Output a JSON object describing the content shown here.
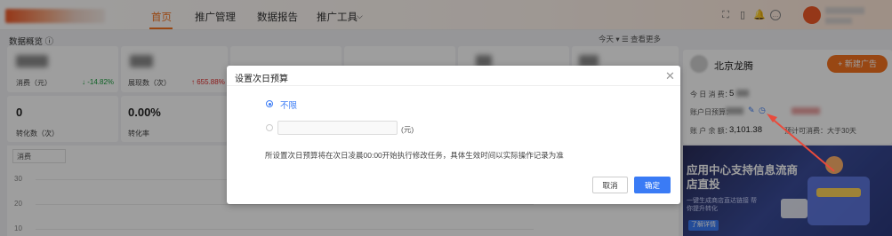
{
  "nav": {
    "items": [
      "首页",
      "推广管理",
      "数据报告",
      "推广工具"
    ],
    "active_index": 0,
    "chevron": "chevron-down-icon"
  },
  "toolbar_icons": [
    "screen-icon",
    "mobile-icon",
    "bell-icon",
    "more-icon"
  ],
  "section": {
    "title": "数据概览 ⓘ",
    "range": "今天 ▾  ☰ 查看更多"
  },
  "metrics": [
    {
      "label": "消费（元）",
      "delta": "↓ -14.82%",
      "delta_color": "#1b9e3e"
    },
    {
      "label": "展现数（次）",
      "delta": "↑ 655.88%",
      "delta_color": "#e02b2b"
    }
  ],
  "metrics_row2": [
    {
      "value": "0",
      "label": "转化数（次）"
    },
    {
      "value": "0.00%",
      "label": "转化率"
    }
  ],
  "chart": {
    "select": "消费",
    "yticks": [
      "30",
      "20",
      "10"
    ]
  },
  "account": {
    "name": "北京龙腾",
    "new_ad_button": "+ 新建广告",
    "today_spend_label": "今 日 消 费：",
    "today_spend_value": "5",
    "budget_label": "账户日预算：",
    "balance_label": "账 户 余 额：",
    "balance_value": "3,101.38",
    "balance_note": "预计可消费：大于30天"
  },
  "banner": {
    "title": "应用中心支持信息流商店直投",
    "sub": "一键生成商店直达链接 帮你提升转化",
    "button": "了解详情"
  },
  "modal": {
    "title": "设置次日预算",
    "option_unlimited": "不限",
    "budget_placeholder": "",
    "unit": "(元)",
    "note": "所设置次日预算将在次日凌晨00:00开始执行修改任务，具体生效时间以实际操作记录为准",
    "cancel": "取消",
    "confirm": "确定",
    "selected": "unlimited"
  },
  "colors": {
    "accent": "#f5731f",
    "primary": "#3a7bf5",
    "arrow": "#e84b3c"
  }
}
